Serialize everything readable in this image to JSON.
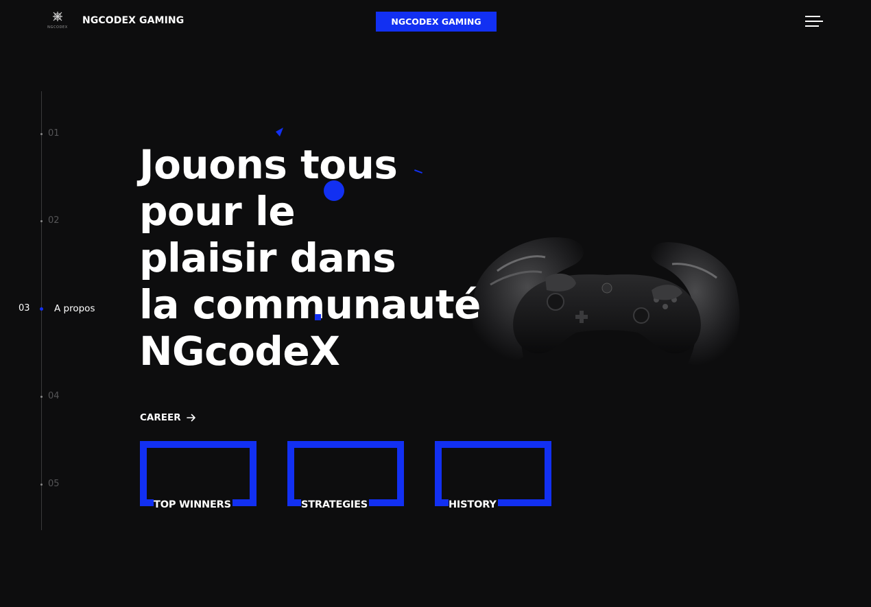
{
  "header": {
    "logo_text": "NGCODEX",
    "brand_title": "NGCODEX GAMING",
    "center_badge": "NGCODEX GAMING",
    "menu_icon": "hamburger-menu-icon"
  },
  "side_nav": {
    "items": [
      {
        "number": "01"
      },
      {
        "number": "02"
      },
      {
        "number": "03",
        "label": "A propos",
        "active": true
      },
      {
        "number": "04"
      },
      {
        "number": "05"
      }
    ]
  },
  "hero": {
    "title_lines": [
      "Jouons tous",
      "pour le",
      "plaisir dans",
      "la communauté",
      "NGcodeX"
    ],
    "cta_label": "CAREER",
    "cta_icon": "arrow-right-icon"
  },
  "cards": [
    {
      "label": "TOP WINNERS"
    },
    {
      "label": "STRATEGIES"
    },
    {
      "label": "HISTORY"
    }
  ],
  "colors": {
    "background": "#0d0d0e",
    "accent": "#1230f2",
    "text": "#ffffff",
    "muted": "#555557"
  }
}
